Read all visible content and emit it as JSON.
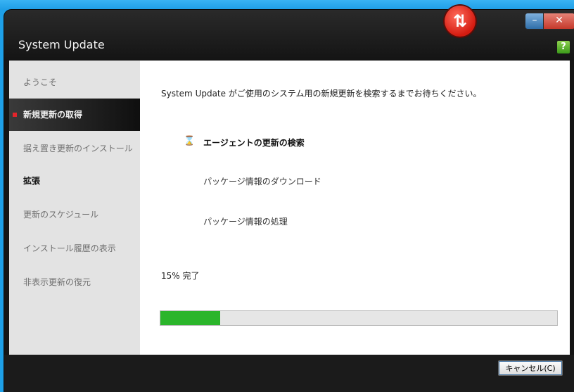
{
  "window": {
    "title": "System Update"
  },
  "sidebar": {
    "items": [
      {
        "label": "ようこそ"
      },
      {
        "label": "新規更新の取得"
      },
      {
        "label": "据え置き更新のインストール"
      },
      {
        "label": "拡張"
      },
      {
        "label": "更新のスケジュール"
      },
      {
        "label": "インストール履歴の表示"
      },
      {
        "label": "非表示更新の復元"
      }
    ]
  },
  "main": {
    "intro": "System Update がご使用のシステム用の新規更新を検索するまでお待ちください。",
    "steps": [
      {
        "label": "エージェントの更新の検索"
      },
      {
        "label": "パッケージ情報のダウンロード"
      },
      {
        "label": "パッケージ情報の処理"
      }
    ],
    "percent_text": "15% 完了",
    "progress": 0.15
  },
  "footer": {
    "cancel_label": "キャンセル(C)"
  },
  "colors": {
    "accent": "#e3242b",
    "progress": "#2bb52b",
    "desktop": "#1ea0e8"
  }
}
